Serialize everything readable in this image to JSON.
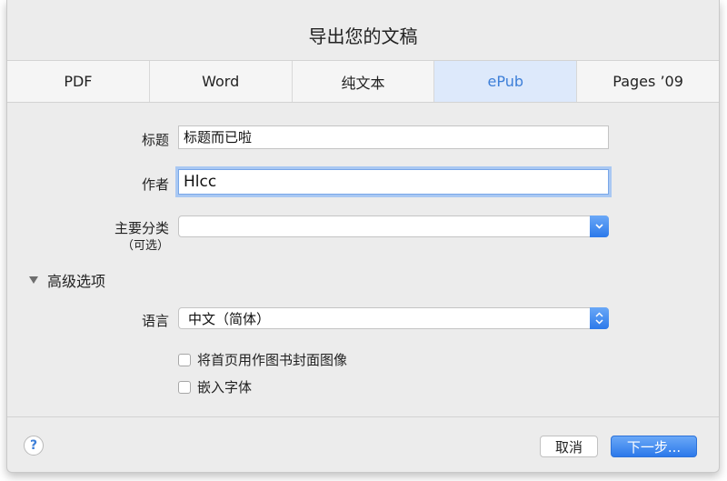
{
  "dialog": {
    "title": "导出您的文稿"
  },
  "tabs": [
    {
      "label": "PDF",
      "selected": false
    },
    {
      "label": "Word",
      "selected": false
    },
    {
      "label": "纯文本",
      "selected": false
    },
    {
      "label": "ePub",
      "selected": true
    },
    {
      "label": "Pages ’09",
      "selected": false
    }
  ],
  "form": {
    "title_label": "标题",
    "title_value": "标题而已啦",
    "author_label": "作者",
    "author_value": "Hlcc",
    "category_label": "主要分类",
    "category_sublabel": "（可选）",
    "category_value": ""
  },
  "advanced": {
    "toggle_label": "高级选项",
    "expanded": true,
    "language_label": "语言",
    "language_value": "中文（简体）",
    "cover_checkbox_label": "将首页用作图书封面图像",
    "cover_checked": false,
    "embed_fonts_label": "嵌入字体",
    "embed_fonts_checked": false
  },
  "footer": {
    "help_label": "?",
    "cancel_label": "取消",
    "next_label": "下一步..."
  },
  "colors": {
    "accent": "#2c79ea",
    "selected_tab_bg": "#dde9fb",
    "selected_tab_text": "#3d7fd8"
  },
  "icons": {
    "popup_down": "chevron-down-icon",
    "popup_updown": "chevron-updown-icon",
    "disclosure": "disclosure-triangle-icon",
    "help": "help-icon"
  }
}
